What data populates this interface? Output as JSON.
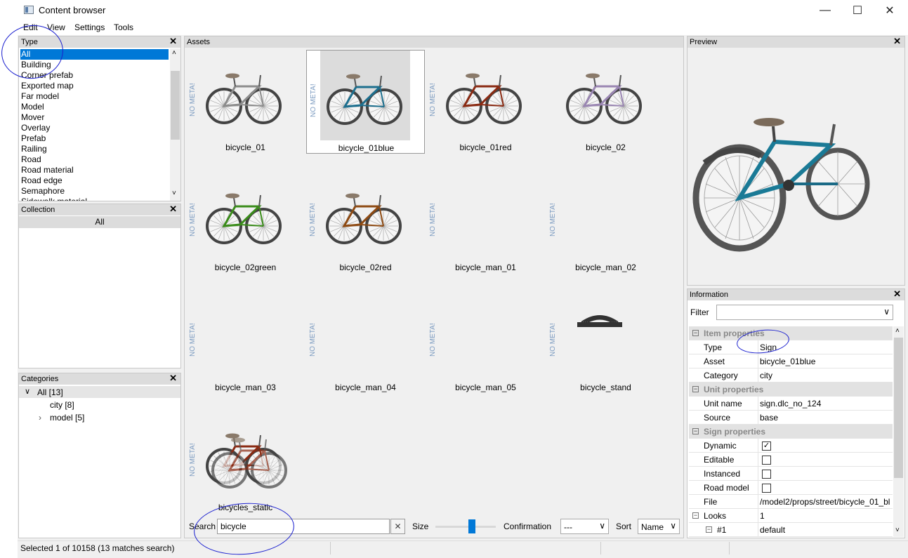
{
  "window": {
    "title": "Content browser",
    "minimize": "—",
    "maximize": "☐",
    "close": "✕"
  },
  "menu": [
    "Edit",
    "View",
    "Settings",
    "Tools"
  ],
  "type_panel": {
    "title": "Type",
    "items": [
      "All",
      "Building",
      "Corner prefab",
      "Exported map",
      "Far model",
      "Model",
      "Mover",
      "Overlay",
      "Prefab",
      "Railing",
      "Road",
      "Road material",
      "Road edge",
      "Semaphore",
      "Sidewalk material"
    ],
    "selected": "All"
  },
  "collection_panel": {
    "title": "Collection",
    "selected": "All"
  },
  "categories_panel": {
    "title": "Categories",
    "tree": [
      {
        "label": "All [13]"
      },
      {
        "label": "city [8]"
      },
      {
        "label": "model [5]"
      }
    ]
  },
  "assets_panel": {
    "title": "Assets",
    "no_meta_label": "NO META!",
    "assets": [
      {
        "name": "bicycle_01",
        "thumb": "bike",
        "color": "#8c8c8c",
        "no_meta": true,
        "selected": false
      },
      {
        "name": "bicycle_01blue",
        "thumb": "bike",
        "color": "#1d6f8e",
        "no_meta": true,
        "selected": true
      },
      {
        "name": "bicycle_01red",
        "thumb": "bike",
        "color": "#8a2a12",
        "no_meta": true,
        "selected": false
      },
      {
        "name": "bicycle_02",
        "thumb": "bike",
        "color": "#9a86b2",
        "no_meta": false,
        "selected": false
      },
      {
        "name": "bicycle_02green",
        "thumb": "bike",
        "color": "#3a8c1a",
        "no_meta": true,
        "selected": false
      },
      {
        "name": "bicycle_02red",
        "thumb": "bike",
        "color": "#8e4a12",
        "no_meta": true,
        "selected": false
      },
      {
        "name": "bicycle_man_01",
        "thumb": "none",
        "color": "",
        "no_meta": true,
        "selected": false
      },
      {
        "name": "bicycle_man_02",
        "thumb": "none",
        "color": "",
        "no_meta": true,
        "selected": false
      },
      {
        "name": "bicycle_man_03",
        "thumb": "none",
        "color": "",
        "no_meta": true,
        "selected": false
      },
      {
        "name": "bicycle_man_04",
        "thumb": "none",
        "color": "",
        "no_meta": true,
        "selected": false
      },
      {
        "name": "bicycle_man_05",
        "thumb": "none",
        "color": "",
        "no_meta": true,
        "selected": false
      },
      {
        "name": "bicycle_stand",
        "thumb": "stand",
        "color": "#333",
        "no_meta": true,
        "selected": false
      },
      {
        "name": "bicycles_static",
        "thumb": "static",
        "color": "#8a2a12",
        "no_meta": true,
        "selected": false
      }
    ]
  },
  "searchbar": {
    "search_label": "Search",
    "search_value": "bicycle",
    "clear_glyph": "✕",
    "size_label": "Size",
    "size_level": 0.6,
    "confirmation_label": "Confirmation",
    "confirmation_value": "---",
    "sort_label": "Sort",
    "sort_value": "Name"
  },
  "preview_panel": {
    "title": "Preview"
  },
  "info_panel": {
    "title": "Information",
    "filter_label": "Filter",
    "filter_value": "",
    "rows": [
      {
        "kind": "section",
        "label": "Item properties"
      },
      {
        "kind": "text",
        "key": "Type",
        "value": "Sign"
      },
      {
        "kind": "text",
        "key": "Asset",
        "value": "bicycle_01blue"
      },
      {
        "kind": "text",
        "key": "Category",
        "value": "city"
      },
      {
        "kind": "section",
        "label": "Unit properties"
      },
      {
        "kind": "text",
        "key": "Unit name",
        "value": "sign.dlc_no_124"
      },
      {
        "kind": "text",
        "key": "Source",
        "value": "base"
      },
      {
        "kind": "section",
        "label": "Sign properties"
      },
      {
        "kind": "check",
        "key": "Dynamic",
        "value": true
      },
      {
        "kind": "check",
        "key": "Editable",
        "value": false
      },
      {
        "kind": "check",
        "key": "Instanced",
        "value": false
      },
      {
        "kind": "check",
        "key": "Road model",
        "value": false
      },
      {
        "kind": "text",
        "key": "File",
        "value": "/model2/props/street/bicycle_01_bl"
      },
      {
        "kind": "expand",
        "key": "Looks",
        "value": "1"
      },
      {
        "kind": "subexpand",
        "key": "#1",
        "value": "default"
      }
    ]
  },
  "status": {
    "text": "Selected 1 of 10158 (13 matches search)"
  }
}
